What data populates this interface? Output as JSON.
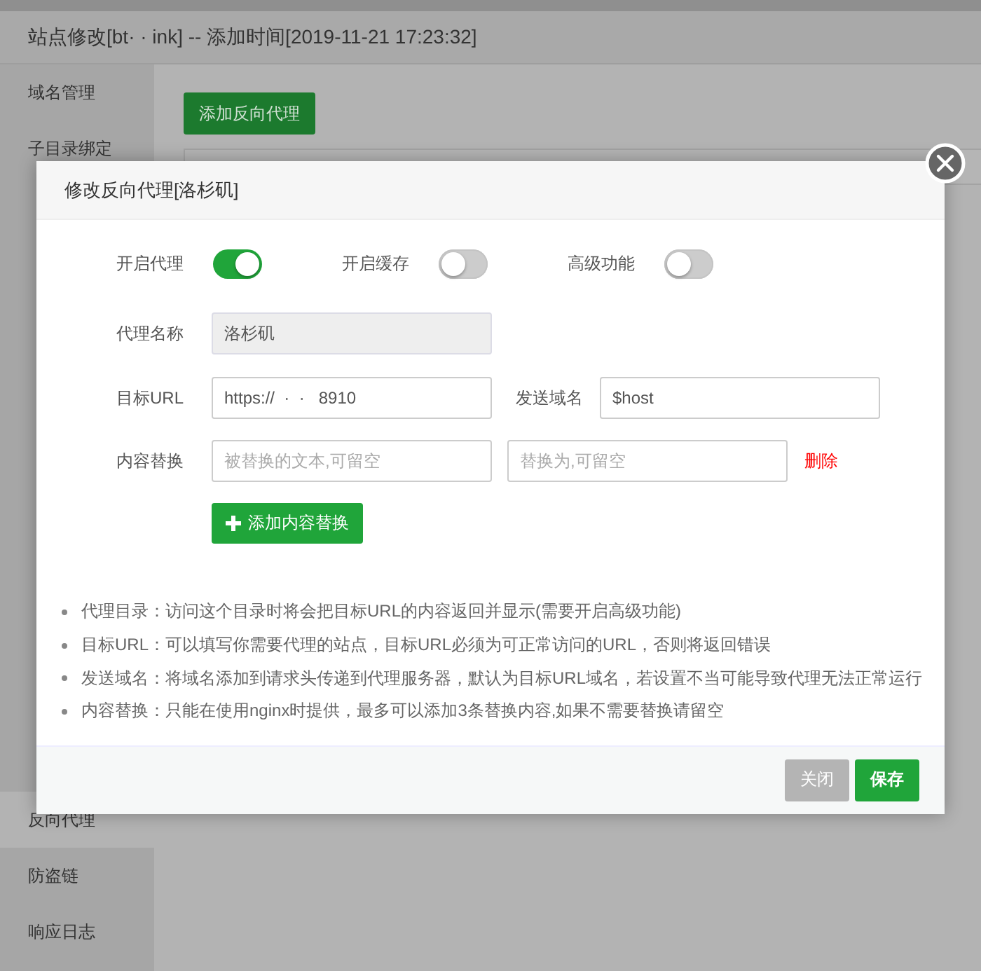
{
  "window": {
    "title": "站点修改[bt·  ·   ink] -- 添加时间[2019-11-21 17:23:32]"
  },
  "sidebar": {
    "top_items": [
      {
        "label": "域名管理",
        "selected": false
      },
      {
        "label": "子目录绑定",
        "selected": false
      }
    ],
    "bottom_items": [
      {
        "label": "反向代理",
        "selected": true
      },
      {
        "label": "防盗链",
        "selected": false
      },
      {
        "label": "响应日志",
        "selected": false
      }
    ]
  },
  "add_proxy_button": "添加反向代理",
  "dialog": {
    "title": "修改反向代理[洛杉矶]",
    "toggles": [
      {
        "label": "开启代理",
        "on": true
      },
      {
        "label": "开启缓存",
        "on": false
      },
      {
        "label": "高级功能",
        "on": false
      }
    ],
    "proxy_name": {
      "label": "代理名称",
      "value": "洛杉矶",
      "disabled": true
    },
    "target_url": {
      "label": "目标URL",
      "value": "https://  ·  ·   8910"
    },
    "send_domain": {
      "label": "发送域名",
      "value": "$host"
    },
    "content_replace": {
      "label": "内容替换",
      "from_placeholder": "被替换的文本,可留空",
      "to_placeholder": "替换为,可留空",
      "delete_link": "删除"
    },
    "add_replace_button": "添加内容替换",
    "notes": [
      "代理目录：访问这个目录时将会把目标URL的内容返回并显示(需要开启高级功能)",
      "目标URL：可以填写你需要代理的站点，目标URL必须为可正常访问的URL，否则将返回错误",
      "发送域名：将域名添加到请求头传递到代理服务器，默认为目标URL域名，若设置不当可能导致代理无法正常运行",
      "内容替换：只能在使用nginx时提供，最多可以添加3条替换内容,如果不需要替换请留空"
    ],
    "buttons": [
      {
        "label": "关闭",
        "kind": "disabled"
      },
      {
        "label": "保存",
        "kind": "primary"
      }
    ]
  }
}
